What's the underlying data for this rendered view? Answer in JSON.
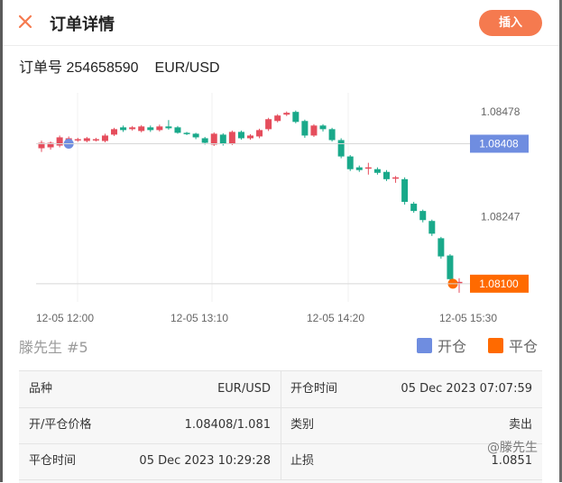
{
  "header": {
    "title": "订单详情",
    "insert_label": "插入",
    "accent": "#f57a4f"
  },
  "order": {
    "number_label": "订单号 254658590",
    "symbol": "EUR/USD"
  },
  "chart_data": {
    "type": "candlestick",
    "x_ticks": [
      "12-05 12:00",
      "12-05 13:10",
      "12-05 14:20",
      "12-05 15:30"
    ],
    "y_ticks": [
      "1.08478",
      "1.08247"
    ],
    "open_price": "1.08408",
    "close_price": "1.08100",
    "ylim": [
      1.0806,
      1.0852
    ],
    "up_color": "#e54d5c",
    "down_color": "#19a98a",
    "candles": [
      [
        1.08398,
        1.0841,
        1.0839,
        1.08415
      ],
      [
        1.084,
        1.0841,
        1.08395,
        1.08413
      ],
      [
        1.08404,
        1.08422,
        1.084,
        1.08426
      ],
      [
        1.08412,
        1.0842,
        1.08408,
        1.08424
      ],
      [
        1.08416,
        1.08418,
        1.08412,
        1.08421
      ],
      [
        1.08414,
        1.0842,
        1.08411,
        1.08423
      ],
      [
        1.08416,
        1.08418,
        1.08413,
        1.08421
      ],
      [
        1.08414,
        1.08426,
        1.08411,
        1.0843
      ],
      [
        1.08428,
        1.0844,
        1.08425,
        1.08443
      ],
      [
        1.08444,
        1.08438,
        1.08434,
        1.08448
      ],
      [
        1.0844,
        1.08444,
        1.08437,
        1.08447
      ],
      [
        1.08436,
        1.08446,
        1.08433,
        1.08449
      ],
      [
        1.08444,
        1.08438,
        1.08434,
        1.08448
      ],
      [
        1.08438,
        1.08446,
        1.08435,
        1.0845
      ],
      [
        1.08446,
        1.08442,
        1.08439,
        1.0846
      ],
      [
        1.08444,
        1.08432,
        1.0843,
        1.08447
      ],
      [
        1.08432,
        1.0843,
        1.08427,
        1.08434
      ],
      [
        1.0843,
        1.08422,
        1.08418,
        1.08432
      ],
      [
        1.0842,
        1.0841,
        1.08406,
        1.08423
      ],
      [
        1.08406,
        1.0843,
        1.08403,
        1.08433
      ],
      [
        1.08428,
        1.08408,
        1.08404,
        1.08431
      ],
      [
        1.08408,
        1.08434,
        1.08405,
        1.08437
      ],
      [
        1.08434,
        1.0842,
        1.08417,
        1.08437
      ],
      [
        1.0842,
        1.08426,
        1.08417,
        1.08429
      ],
      [
        1.08424,
        1.08438,
        1.0842,
        1.08441
      ],
      [
        1.0844,
        1.08462,
        1.08436,
        1.08465
      ],
      [
        1.08458,
        1.0847,
        1.08455,
        1.08473
      ],
      [
        1.08472,
        1.08476,
        1.08469,
        1.08479
      ],
      [
        1.08478,
        1.08456,
        1.08453,
        1.08481
      ],
      [
        1.08458,
        1.08426,
        1.08421,
        1.08461
      ],
      [
        1.08426,
        1.08448,
        1.08423,
        1.08451
      ],
      [
        1.08448,
        1.0844,
        1.08435,
        1.08451
      ],
      [
        1.0844,
        1.08416,
        1.08413,
        1.08443
      ],
      [
        1.08416,
        1.0838,
        1.08376,
        1.0842
      ],
      [
        1.0838,
        1.08352,
        1.08348,
        1.08383
      ],
      [
        1.08356,
        1.0835,
        1.08346,
        1.0836
      ],
      [
        1.08354,
        1.08356,
        1.0834,
        1.08366
      ],
      [
        1.08352,
        1.08344,
        1.0834,
        1.08356
      ],
      [
        1.08346,
        1.0833,
        1.08326,
        1.0835
      ],
      [
        1.08334,
        1.08334,
        1.08322,
        1.08337
      ],
      [
        1.0833,
        1.0828,
        1.08274,
        1.08334
      ],
      [
        1.08276,
        1.0826,
        1.08256,
        1.0828
      ],
      [
        1.0826,
        1.0824,
        1.08235,
        1.08263
      ],
      [
        1.08238,
        1.0821,
        1.08205,
        1.08241
      ],
      [
        1.082,
        1.0816,
        1.08155,
        1.08203
      ],
      [
        1.08162,
        1.0811,
        1.08106,
        1.08165
      ],
      [
        1.08102,
        1.08104,
        1.0808,
        1.08112
      ]
    ]
  },
  "user": {
    "label": "滕先生 #5"
  },
  "legend": [
    {
      "label": "开仓",
      "color": "#6f8de0"
    },
    {
      "label": "平仓",
      "color": "#ff6a00"
    }
  ],
  "details": [
    {
      "left_label": "品种",
      "left_value": "EUR/USD",
      "right_label": "开仓时间",
      "right_value": "05 Dec 2023 07:07:59"
    },
    {
      "left_label": "开/平仓价格",
      "left_value": "1.08408/1.081",
      "right_label": "类别",
      "right_value": "卖出"
    },
    {
      "left_label": "平仓时间",
      "left_value": "05 Dec 2023 10:29:28",
      "right_label": "止损",
      "right_value": "1.0851"
    }
  ],
  "watermark": "@滕先生"
}
